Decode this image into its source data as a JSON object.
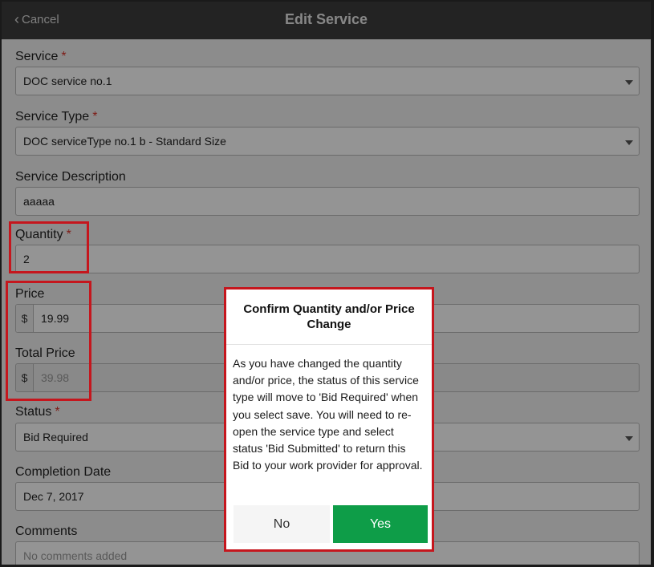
{
  "header": {
    "cancel_label": "Cancel",
    "title": "Edit Service"
  },
  "form": {
    "service": {
      "label": "Service",
      "required_mark": "*",
      "value": "DOC service no.1"
    },
    "service_type": {
      "label": "Service Type",
      "required_mark": "*",
      "value": "DOC serviceType no.1 b - Standard Size"
    },
    "service_description": {
      "label": "Service Description",
      "value": "aaaaa"
    },
    "quantity": {
      "label": "Quantity",
      "required_mark": "*",
      "value": "2"
    },
    "price": {
      "label": "Price",
      "currency": "$",
      "value": "19.99"
    },
    "total_price": {
      "label": "Total Price",
      "currency": "$",
      "value": "39.98"
    },
    "status": {
      "label": "Status",
      "required_mark": "*",
      "value": "Bid Required"
    },
    "completion_date": {
      "label": "Completion Date",
      "value": "Dec 7, 2017"
    },
    "comments": {
      "label": "Comments",
      "placeholder": "No comments added"
    }
  },
  "modal": {
    "title": "Confirm Quantity and/or Price Change",
    "body": "As you have changed the quantity and/or price, the status of this service type will move to 'Bid Required' when you select save. You will need to re-open the service type and select status 'Bid Submitted' to return this Bid to your work provider for approval.",
    "no_label": "No",
    "yes_label": "Yes"
  },
  "colors": {
    "header_bg": "#3d3d3d",
    "highlight_red": "#c5161d",
    "yes_green": "#0e9d48",
    "required_red": "#d9342b"
  },
  "icons": [
    "chevron-left-icon",
    "dropdown-caret-icon"
  ]
}
